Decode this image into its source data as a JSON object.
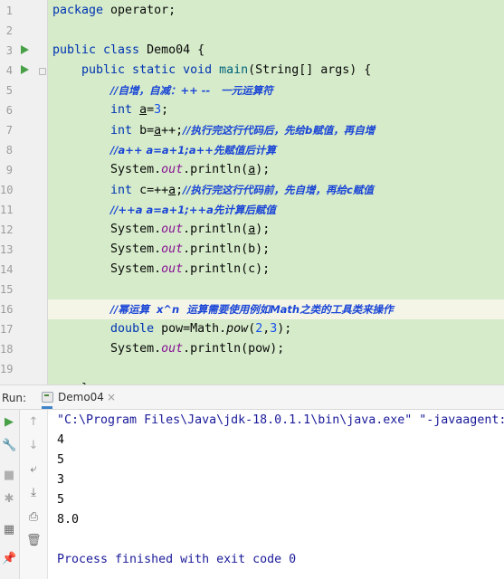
{
  "editor": {
    "lines": [
      {
        "n": "1",
        "tokens": [
          {
            "t": "package ",
            "c": "kw"
          },
          {
            "t": "operator;",
            "c": ""
          }
        ]
      },
      {
        "n": "2",
        "tokens": []
      },
      {
        "n": "3",
        "run": true,
        "fold": false,
        "tokens": [
          {
            "t": "public class ",
            "c": "kw"
          },
          {
            "t": "Demo04 {",
            "c": ""
          }
        ]
      },
      {
        "n": "4",
        "run": true,
        "fold": true,
        "tokens": [
          {
            "t": "    public static void ",
            "c": "kw"
          },
          {
            "t": "main",
            "c": "fn"
          },
          {
            "t": "(String[] args) {",
            "c": ""
          }
        ]
      },
      {
        "n": "5",
        "tokens": [
          {
            "t": "        ",
            "c": ""
          },
          {
            "t": "//自增，自减：++ --   一元运算符",
            "c": "cm"
          }
        ]
      },
      {
        "n": "6",
        "tokens": [
          {
            "t": "        ",
            "c": ""
          },
          {
            "t": "int ",
            "c": "kw"
          },
          {
            "t": "a",
            "c": "ul"
          },
          {
            "t": "=",
            "c": ""
          },
          {
            "t": "3",
            "c": "num"
          },
          {
            "t": ";",
            "c": ""
          }
        ]
      },
      {
        "n": "7",
        "tokens": [
          {
            "t": "        ",
            "c": ""
          },
          {
            "t": "int ",
            "c": "kw"
          },
          {
            "t": "b=",
            "c": ""
          },
          {
            "t": "a",
            "c": "ul"
          },
          {
            "t": "++;",
            "c": ""
          },
          {
            "t": "//执行完这行代码后，先给b赋值，再自增",
            "c": "cm"
          }
        ]
      },
      {
        "n": "8",
        "tokens": [
          {
            "t": "        ",
            "c": ""
          },
          {
            "t": "//a++ a=a+1;a++先赋值后计算",
            "c": "cm"
          }
        ]
      },
      {
        "n": "9",
        "tokens": [
          {
            "t": "        System.",
            "c": ""
          },
          {
            "t": "out",
            "c": "fld"
          },
          {
            "t": ".println(",
            "c": ""
          },
          {
            "t": "a",
            "c": "ul"
          },
          {
            "t": ");",
            "c": ""
          }
        ]
      },
      {
        "n": "10",
        "tokens": [
          {
            "t": "        ",
            "c": ""
          },
          {
            "t": "int ",
            "c": "kw"
          },
          {
            "t": "c=++",
            "c": ""
          },
          {
            "t": "a",
            "c": "ul"
          },
          {
            "t": ";",
            "c": ""
          },
          {
            "t": "//执行完这行代码前，先自增，再给c赋值",
            "c": "cm"
          }
        ]
      },
      {
        "n": "11",
        "tokens": [
          {
            "t": "        ",
            "c": ""
          },
          {
            "t": "//++a a=a+1;++a先计算后赋值",
            "c": "cm"
          }
        ]
      },
      {
        "n": "12",
        "tokens": [
          {
            "t": "        System.",
            "c": ""
          },
          {
            "t": "out",
            "c": "fld"
          },
          {
            "t": ".println(",
            "c": ""
          },
          {
            "t": "a",
            "c": "ul"
          },
          {
            "t": ");",
            "c": ""
          }
        ]
      },
      {
        "n": "13",
        "tokens": [
          {
            "t": "        System.",
            "c": ""
          },
          {
            "t": "out",
            "c": "fld"
          },
          {
            "t": ".println(b);",
            "c": ""
          }
        ]
      },
      {
        "n": "14",
        "tokens": [
          {
            "t": "        System.",
            "c": ""
          },
          {
            "t": "out",
            "c": "fld"
          },
          {
            "t": ".println(c);",
            "c": ""
          }
        ]
      },
      {
        "n": "15",
        "tokens": []
      },
      {
        "n": "16",
        "highlight": true,
        "tokens": [
          {
            "t": "        ",
            "c": ""
          },
          {
            "t": "//幂运算  x^n  运算需要使用例如Math之类的工具类来操作",
            "c": "cm"
          }
        ]
      },
      {
        "n": "17",
        "tokens": [
          {
            "t": "        ",
            "c": ""
          },
          {
            "t": "double ",
            "c": "kw"
          },
          {
            "t": "pow=Math.",
            "c": ""
          },
          {
            "t": "pow",
            "c": "sm"
          },
          {
            "t": "(",
            "c": ""
          },
          {
            "t": "2",
            "c": "num"
          },
          {
            "t": ",",
            "c": ""
          },
          {
            "t": "3",
            "c": "num"
          },
          {
            "t": ");",
            "c": ""
          }
        ]
      },
      {
        "n": "18",
        "tokens": [
          {
            "t": "        System.",
            "c": ""
          },
          {
            "t": "out",
            "c": "fld"
          },
          {
            "t": ".println(pow);",
            "c": ""
          }
        ]
      },
      {
        "n": "19",
        "tokens": []
      },
      {
        "n": "",
        "tokens": [
          {
            "t": "    }",
            "c": ""
          }
        ]
      }
    ]
  },
  "run_panel": {
    "label": "Run:",
    "tab_label": "Demo04",
    "tab_close": "×",
    "console": [
      {
        "text": "\"C:\\Program Files\\Java\\jdk-18.0.1.1\\bin\\java.exe\" \"-javaagent:",
        "kind": "cmd"
      },
      {
        "text": "4",
        "kind": "val"
      },
      {
        "text": "5",
        "kind": "val"
      },
      {
        "text": "3",
        "kind": "val"
      },
      {
        "text": "5",
        "kind": "val"
      },
      {
        "text": "8.0",
        "kind": "val"
      },
      {
        "text": "",
        "kind": "val"
      },
      {
        "text": "Process finished with exit code 0",
        "kind": "fin"
      }
    ]
  },
  "toolbar_left": [
    {
      "name": "rerun-icon",
      "glyph": "▶",
      "color": "#48a047"
    },
    {
      "name": "wrench-icon",
      "glyph": "🔧",
      "color": "#6b6b6b"
    },
    {
      "name": "stop-icon",
      "glyph": "■",
      "color": "#b0b0b0"
    },
    {
      "name": "debug-icon",
      "glyph": "✱",
      "color": "#a8a8a8"
    },
    {
      "name": "layout-icon",
      "glyph": "▦",
      "color": "#6b6b6b"
    },
    {
      "name": "pin-icon",
      "glyph": "📌",
      "color": "#6b6b6b"
    }
  ],
  "toolbar_right": [
    {
      "name": "up-arrow-icon",
      "glyph": "↑",
      "color": "#aaaaaa"
    },
    {
      "name": "down-arrow-icon",
      "glyph": "↓",
      "color": "#aaaaaa"
    },
    {
      "name": "soft-wrap-icon",
      "glyph": "⤶",
      "color": "#6b6b6b"
    },
    {
      "name": "scroll-to-end-icon",
      "glyph": "⤓",
      "color": "#6b6b6b"
    },
    {
      "name": "print-icon",
      "glyph": "⎙",
      "color": "#6b6b6b"
    },
    {
      "name": "trash-icon",
      "glyph": "🗑",
      "color": "#6b6b6b"
    }
  ]
}
